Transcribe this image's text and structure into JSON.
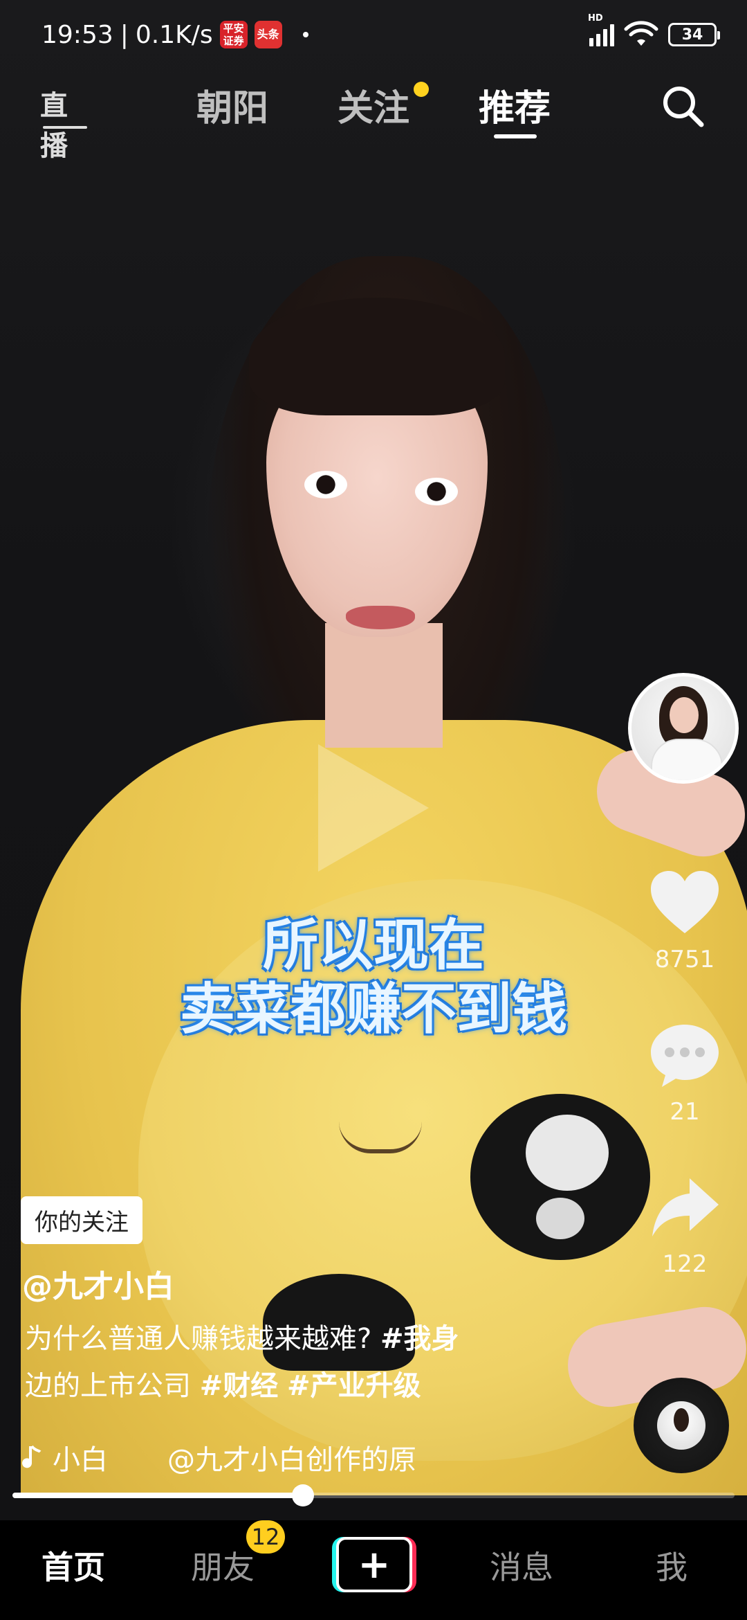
{
  "status_bar": {
    "time": "19:53",
    "network_speed": "0.1K/s",
    "app_badge_1": "平安证券",
    "app_badge_2": "头条",
    "network_type": "HD",
    "battery": "34"
  },
  "top_nav": {
    "live_label": "直播",
    "tabs": [
      {
        "label": "朝阳"
      },
      {
        "label": "关注"
      },
      {
        "label": "推荐"
      }
    ],
    "active_tab": "推荐",
    "follow_dot_color": "#ffd21f"
  },
  "video": {
    "subtitle_line1": "所以现在",
    "subtitle_line2": "卖菜都赚不到钱",
    "paused": true
  },
  "right_rail": {
    "likes": "8751",
    "comments": "21",
    "shares": "122"
  },
  "post": {
    "follow_tag": "你的关注",
    "author": "@九才小白",
    "description_line1": "为什么普通人赚钱越来越难? ",
    "tag1": "#我身",
    "description_line2": "边的上市公司 ",
    "tag2": "#财经",
    "tag3": "#产业升级",
    "music_author": "小白",
    "music_title": "@九才小白创作的原"
  },
  "progress": {
    "fraction": 0.402
  },
  "bottom_nav": {
    "home": "首页",
    "friends": "朋友",
    "friends_badge": "12",
    "create": "+",
    "messages": "消息",
    "me": "我"
  },
  "colors": {
    "accent_yellow": "#ffce1f",
    "subtitle_glow": "#2d8ff0",
    "create_cyan": "#25f4ee",
    "create_pink": "#fe2c55"
  }
}
